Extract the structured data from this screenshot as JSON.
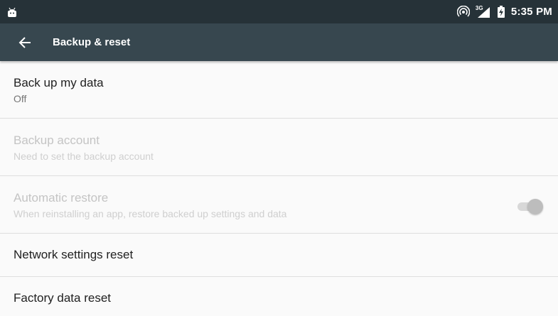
{
  "status_bar": {
    "time": "5:35 PM",
    "network_type": "3G",
    "icons": [
      "android-icon",
      "hotspot-icon",
      "signal-icon",
      "battery-icon"
    ]
  },
  "toolbar": {
    "title": "Backup & reset",
    "back_icon": "arrow-back-icon"
  },
  "settings": [
    {
      "title": "Back up my data",
      "summary": "Off",
      "enabled": true
    },
    {
      "title": "Backup account",
      "summary": "Need to set the backup account",
      "enabled": false
    },
    {
      "title": "Automatic restore",
      "summary": "When reinstalling an app, restore backed up settings and data",
      "enabled": false,
      "switch_on": true
    },
    {
      "title": "Network settings reset",
      "enabled": true
    },
    {
      "title": "Factory data reset",
      "enabled": true
    }
  ],
  "colors": {
    "status_bar": "#263238",
    "toolbar": "#37474f",
    "background": "#fafafa",
    "divider": "#dedede",
    "text_primary": "#212121",
    "text_disabled": "#c4c4c4"
  }
}
